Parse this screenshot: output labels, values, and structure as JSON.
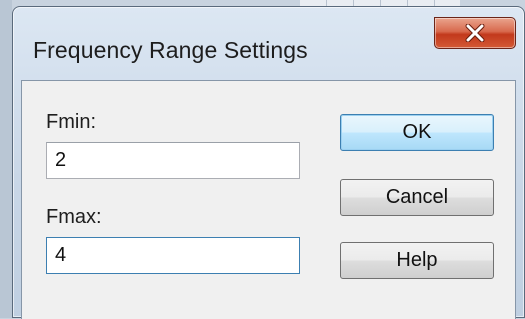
{
  "dialog": {
    "title": "Frequency Range Settings",
    "close_icon": "close-x-icon",
    "accent_color": "#3c7fb1",
    "close_color": "#c2391c"
  },
  "fields": {
    "fmin": {
      "label": "Fmin:",
      "value": "2"
    },
    "fmax": {
      "label": "Fmax:",
      "value": "4"
    }
  },
  "buttons": {
    "ok": "OK",
    "cancel": "Cancel",
    "help": "Help"
  }
}
